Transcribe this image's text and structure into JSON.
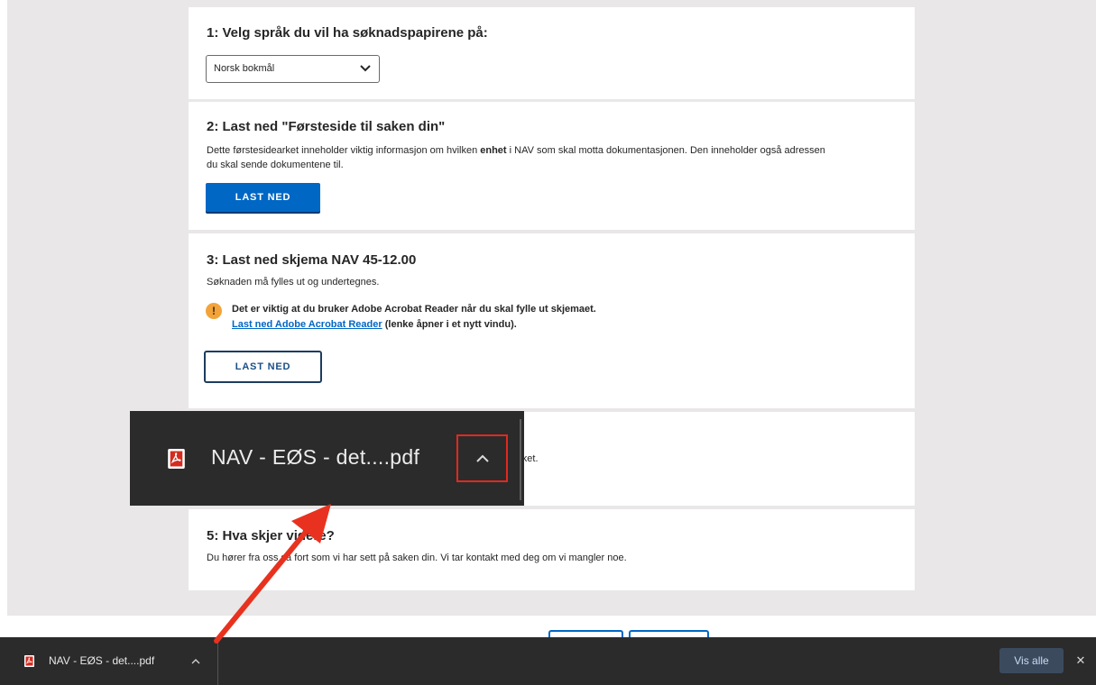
{
  "sections": [
    {
      "title": "1: Velg språk du vil ha søknadspapirene på:",
      "select": {
        "value": "Norsk bokmål"
      }
    },
    {
      "title": "2: Last ned \"Førsteside til saken din\"",
      "text_before": "Dette førstesidearket inneholder viktig informasjon om hvilken ",
      "text_bold": "enhet",
      "text_after": " i NAV som skal motta dokumentasjonen. Den inneholder også adressen",
      "text_line2": "du skal sende dokumentene til.",
      "button": "LAST NED"
    },
    {
      "title": "3: Last ned skjema NAV 45-12.00",
      "text": "Søknaden må fylles ut og undertegnes.",
      "warning_icon": "!",
      "warning": "Det er viktig at du bruker Adobe Acrobat Reader når du skal fylle ut skjemaet.",
      "link": "Last ned Adobe Acrobat Reader",
      "link_suffix": " (lenke åpner i et nytt vindu).",
      "button": "LAST NED"
    },
    {
      "partial_text": "arket."
    },
    {
      "title": "5: Hva skjer videre?",
      "text": "Du hører fra oss så fort som vi har sett på saken din. Vi tar kontakt med deg om vi mangler noe."
    }
  ],
  "download_bar": {
    "file_name": "NAV - EØS - det....pdf",
    "file_icon": "pdf-file-icon",
    "caret_icon": "chevron-up-icon",
    "show_all": "Vis alle",
    "close": "✕"
  },
  "zoom_callout": {
    "file_name": "NAV - EØS - det....pdf",
    "highlight_color": "#e2291f"
  },
  "colors": {
    "accent": "#0067c5",
    "warning": "#f2a43a",
    "arrow": "#e8321f",
    "download_bar": "#2b2b2b"
  }
}
